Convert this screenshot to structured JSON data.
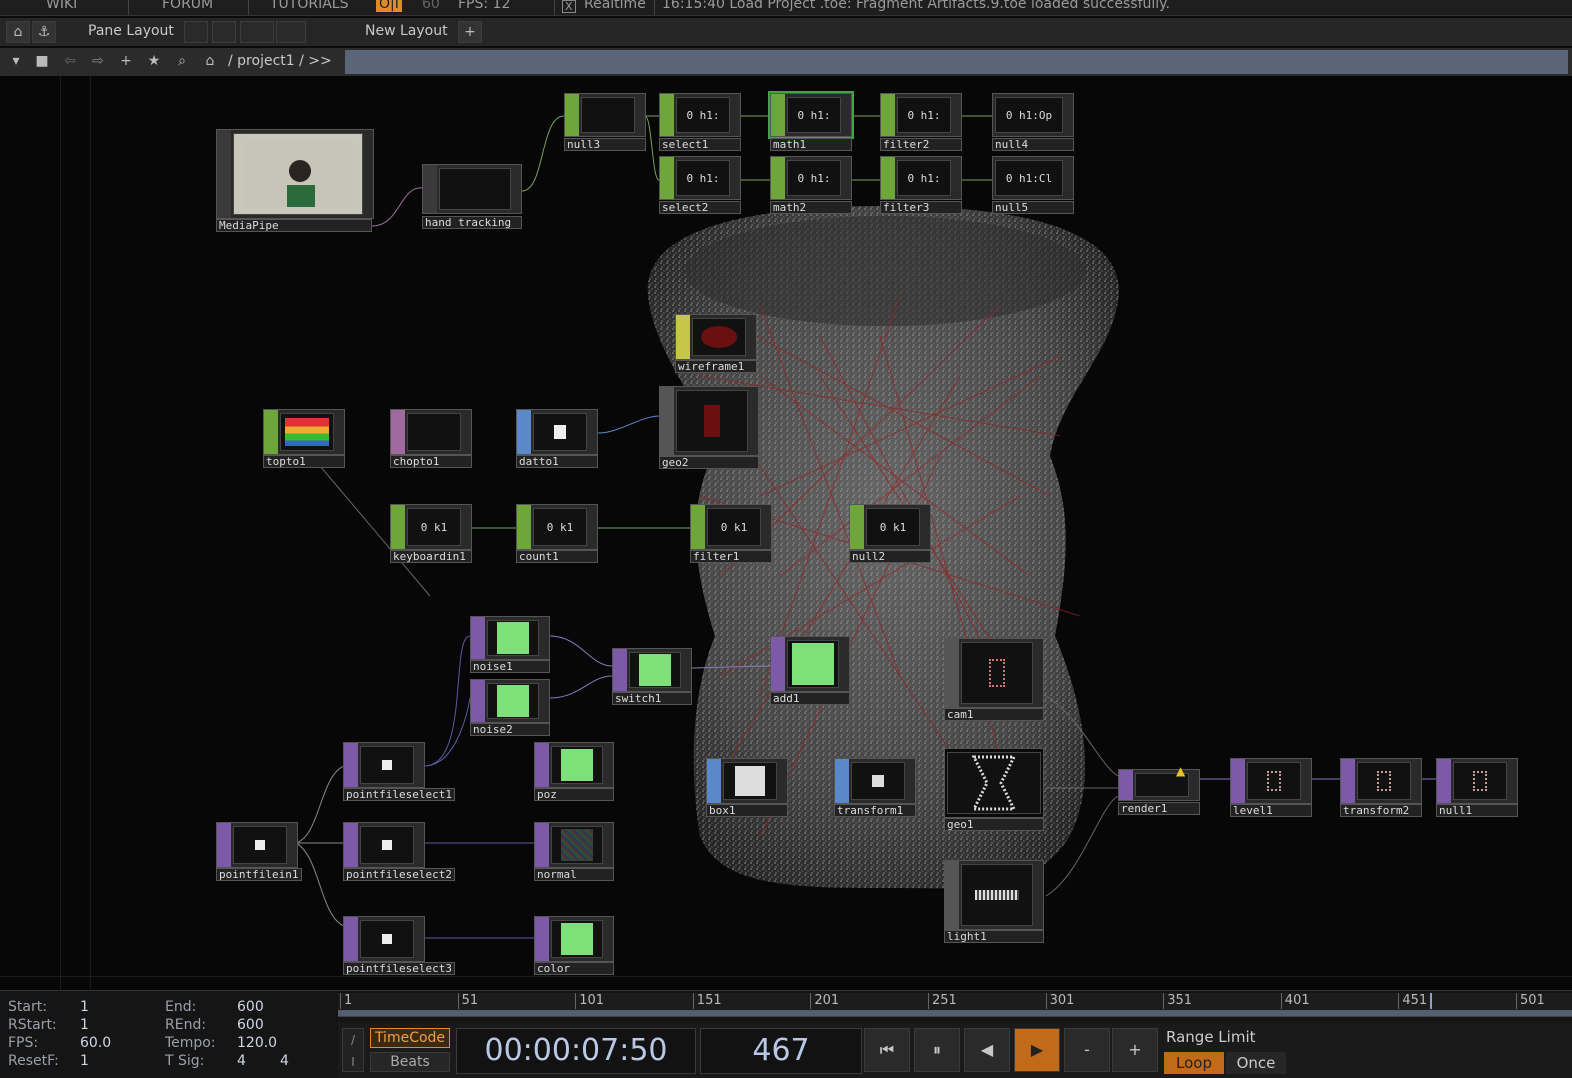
{
  "menu": {
    "wiki": "WIKI",
    "forum": "FORUM",
    "tutorials": "TUTORIALS",
    "perf": "O|I",
    "target_fps": "60",
    "fps": "FPS: 12",
    "realtime_check": "X",
    "realtime": "Realtime",
    "status": "16:15:40 Load Project .toe: Fragment Artifacts.9.toe loaded successfully."
  },
  "toolbar": {
    "pane_layout": "Pane Layout",
    "new_layout": "New Layout",
    "add": "+",
    "path": "/ project1 / >>"
  },
  "nodes": {
    "mediapipe": "MediaPipe",
    "hand_tracking": "hand_tracking",
    "null3": "null3",
    "select1": "select1",
    "math1": "math1",
    "filter2": "filter2",
    "null4": "null4",
    "select2": "select2",
    "math2": "math2",
    "filter3": "filter3",
    "null5": "null5",
    "v_select1": "0 h1:",
    "v_math1": "0 h1:",
    "v_filter2": "0 h1:",
    "v_null4": "0 h1:Op",
    "v_select2": "0 h1:",
    "v_math2": "0 h1:",
    "v_filter3": "0 h1:",
    "v_null5": "0 h1:Cl",
    "wireframe1": "wireframe1",
    "topto1": "topto1",
    "chopto1": "chopto1",
    "datto1": "datto1",
    "geo2": "geo2",
    "keyboardin1": "keyboardin1",
    "count1": "count1",
    "filter1": "filter1",
    "null2": "null2",
    "v_k1": "0 k1",
    "noise1": "noise1",
    "noise2": "noise2",
    "switch1": "switch1",
    "add1": "add1",
    "cam1": "cam1",
    "pointfileselect1": "pointfileselect1",
    "pointfileselect2": "pointfileselect2",
    "pointfileselect3": "pointfileselect3",
    "pointfilein1": "pointfilein1",
    "poz": "poz",
    "normal": "normal",
    "color": "color",
    "box1": "box1",
    "transform1": "transform1",
    "geo1": "geo1",
    "light1": "light1",
    "render1": "render1",
    "level1": "level1",
    "transform2": "transform2",
    "null1": "null1"
  },
  "stats": {
    "start_k": "Start:",
    "start_v": "1",
    "end_k": "End:",
    "end_v": "600",
    "rstart_k": "RStart:",
    "rstart_v": "1",
    "rend_k": "REnd:",
    "rend_v": "600",
    "fps_k": "FPS:",
    "fps_v": "60.0",
    "tempo_k": "Tempo:",
    "tempo_v": "120.0",
    "resetf_k": "ResetF:",
    "resetf_v": "1",
    "tsig_k": "T Sig:",
    "tsig_v1": "4",
    "tsig_v2": "4"
  },
  "timeline": {
    "ticks": [
      "1",
      "51",
      "101",
      "151",
      "201",
      "251",
      "301",
      "351",
      "401",
      "451",
      "501"
    ]
  },
  "transport": {
    "timecode_btn": "TimeCode",
    "beats_btn": "Beats",
    "timecode": "00:00:07:50",
    "frame": "467",
    "first": "⏮",
    "pause": "⏸",
    "step_back": "◀",
    "play": "▶",
    "minus": "-",
    "plus": "+",
    "range_limit": "Range Limit",
    "loop": "Loop",
    "once": "Once"
  },
  "colors": {
    "chop": "#6ea63c",
    "top": "#7c5aa8",
    "sop": "#5b88c8",
    "accent": "#e08a2a",
    "path_bar": "#5a6578"
  }
}
